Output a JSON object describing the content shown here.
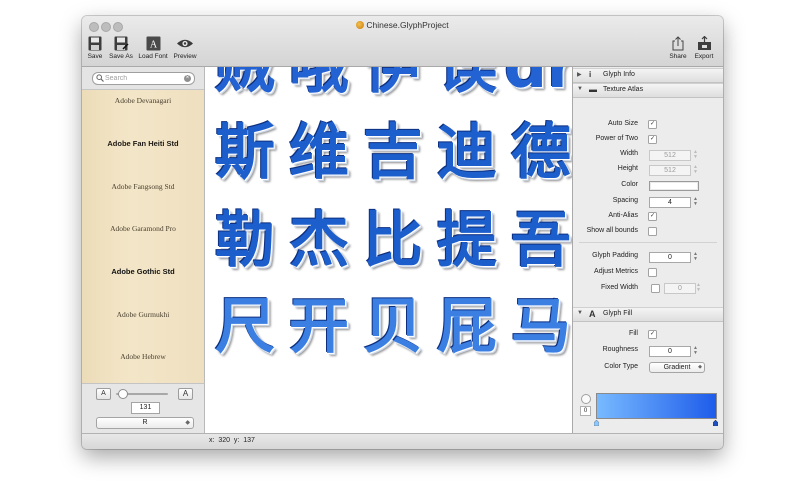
{
  "window": {
    "title": "Chinese.GlyphProject"
  },
  "toolbar": {
    "save": "Save",
    "save_as": "Save As",
    "load_font": "Load Font",
    "preview": "Preview",
    "share": "Share",
    "export": "Export"
  },
  "sidebar": {
    "search_placeholder": "Search",
    "fonts": [
      "Adobe Devanagari",
      "Adobe Fan Heiti Std",
      "Adobe Fangsong Std",
      "Adobe Garamond Pro",
      "Adobe Gothic Std",
      "Adobe Gurmukhi",
      "Adobe Hebrew"
    ],
    "selected_font": "Adobe Gothic Std",
    "size_small_label": "A",
    "size_large_label": "A",
    "font_size": "131",
    "font_size_slider_fraction": 0.12,
    "style": "R"
  },
  "canvas": {
    "rows": [
      [
        "贼",
        "哦",
        "伊",
        "误",
        "drop"
      ],
      [
        "斯",
        "维",
        "吉",
        "迪",
        "德"
      ],
      [
        "勒",
        "杰",
        "比",
        "提",
        "吾"
      ],
      [
        "尺",
        "开",
        "贝",
        "屁",
        "马"
      ]
    ]
  },
  "status": {
    "x_label": "x:",
    "x_value": "320",
    "y_label": "y:",
    "y_value": "137"
  },
  "inspector": {
    "glyph_info": {
      "title": "Glyph Info"
    },
    "texture_atlas": {
      "title": "Texture Atlas",
      "auto_size_label": "Auto Size",
      "auto_size": true,
      "power_of_two_label": "Power of Two",
      "power_of_two": true,
      "width_label": "Width",
      "width": "512",
      "height_label": "Height",
      "height": "512",
      "color_label": "Color",
      "spacing_label": "Spacing",
      "spacing": "4",
      "anti_alias_label": "Anti-Alias",
      "anti_alias": true,
      "show_all_bounds_label": "Show all bounds",
      "show_all_bounds": false,
      "glyph_padding_label": "Glyph Padding",
      "glyph_padding": "0",
      "adjust_metrics_label": "Adjust Metrics",
      "adjust_metrics": false,
      "fixed_width_label": "Fixed Width",
      "fixed_width_enabled": false,
      "fixed_width": "0"
    },
    "glyph_fill": {
      "title": "Glyph Fill",
      "fill_label": "Fill",
      "fill": true,
      "roughness_label": "Roughness",
      "roughness": "0",
      "color_type_label": "Color Type",
      "color_type": "Gradient",
      "gradient_angle": "0",
      "gradient_start_color": "#78baff",
      "gradient_end_color": "#1e5cea"
    }
  },
  "colors": {
    "glyph_blue": "#1c5ecc",
    "sidebar_parchment": "#f1e3c4"
  }
}
